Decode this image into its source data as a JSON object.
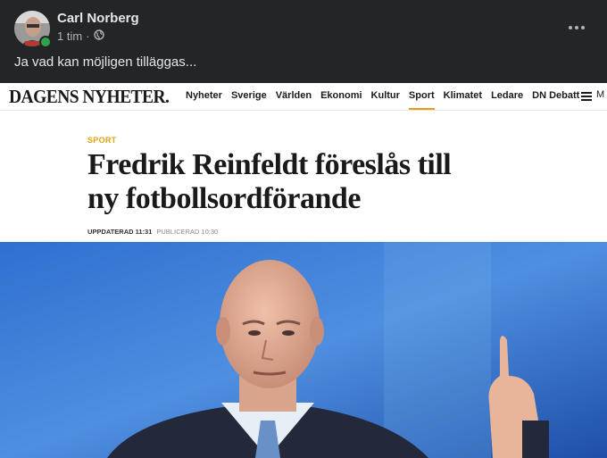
{
  "post": {
    "author": "Carl Norberg",
    "time": "1 tim",
    "separator": "·",
    "text": "Ja vad kan möjligen tilläggas..."
  },
  "article": {
    "logo": "DAGENS NYHETER.",
    "nav": [
      "Nyheter",
      "Sverige",
      "Världen",
      "Ekonomi",
      "Kultur",
      "Sport",
      "Klimatet",
      "Ledare",
      "DN Debatt"
    ],
    "active_nav": "Sport",
    "menu_label": "M",
    "kicker": "SPORT",
    "headline_line1": "Fredrik Reinfeldt föreslås till",
    "headline_line2": "ny fotbollsordförande",
    "updated": "UPPDATERAD 11:31",
    "published": "PUBLICERAD 10:30"
  },
  "colors": {
    "accent": "#e0a110",
    "online": "#31a24c",
    "post_bg": "#242526"
  },
  "icons": [
    "globe-icon",
    "more-options-icon",
    "menu-icon"
  ]
}
